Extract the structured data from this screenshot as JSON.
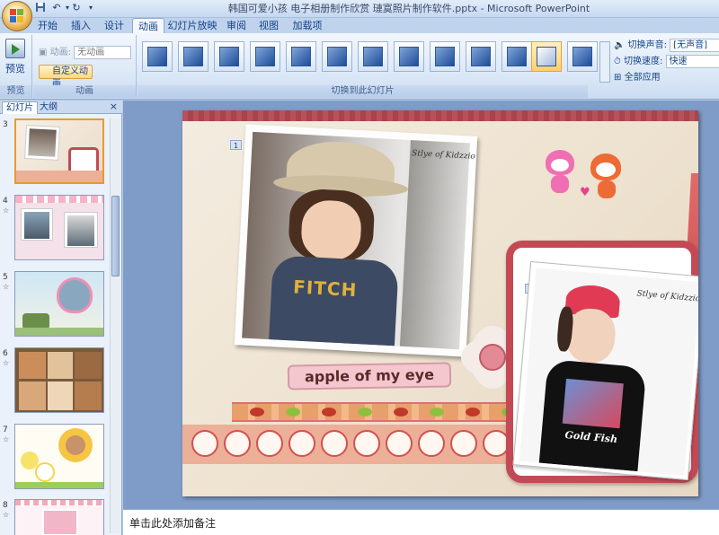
{
  "window": {
    "title": "韩国可爱小孩 电子相册制作欣赏  璉寞照片制作软件.pptx - Microsoft PowerPoint"
  },
  "quick_access": {
    "save_icon": "save-icon",
    "undo_icon": "undo-icon",
    "redo_icon": "redo-icon"
  },
  "ribbon_tabs": [
    {
      "label": "开始"
    },
    {
      "label": "插入"
    },
    {
      "label": "设计"
    },
    {
      "label": "动画"
    },
    {
      "label": "幻灯片放映"
    },
    {
      "label": "审阅"
    },
    {
      "label": "视图"
    },
    {
      "label": "加载项"
    }
  ],
  "ribbon": {
    "preview": {
      "button_label": "预览",
      "group_label": "预览"
    },
    "animation": {
      "animate_label": "动画:",
      "animate_value": "无动画",
      "custom_button": "自定义动画",
      "group_label": "动画"
    },
    "transition": {
      "group_label": "切换到此幻灯片",
      "sound_label": "切换声音:",
      "sound_value": "[无声音]",
      "speed_label": "切换速度:",
      "speed_value": "快速",
      "apply_all": "全部应用"
    }
  },
  "left_panel": {
    "tabs": [
      "幻灯片",
      "大纲"
    ],
    "close_glyph": "×",
    "slides": [
      {
        "number": "3",
        "selected": true
      },
      {
        "number": "4",
        "selected": false
      },
      {
        "number": "5",
        "selected": false
      },
      {
        "number": "6",
        "selected": false
      },
      {
        "number": "7",
        "selected": false
      },
      {
        "number": "8",
        "selected": false
      }
    ]
  },
  "slide": {
    "badge_1": "1",
    "badge_2": "2",
    "photo1_tag": "Stlye of Kidzzio",
    "photo2_tag": "Stlye of Kidzzio",
    "apple_label": "apple of my eye",
    "shirt_text": "FITCH",
    "shirt2_text": "Gold Fish"
  },
  "notes": {
    "placeholder": "单击此处添加备注"
  }
}
